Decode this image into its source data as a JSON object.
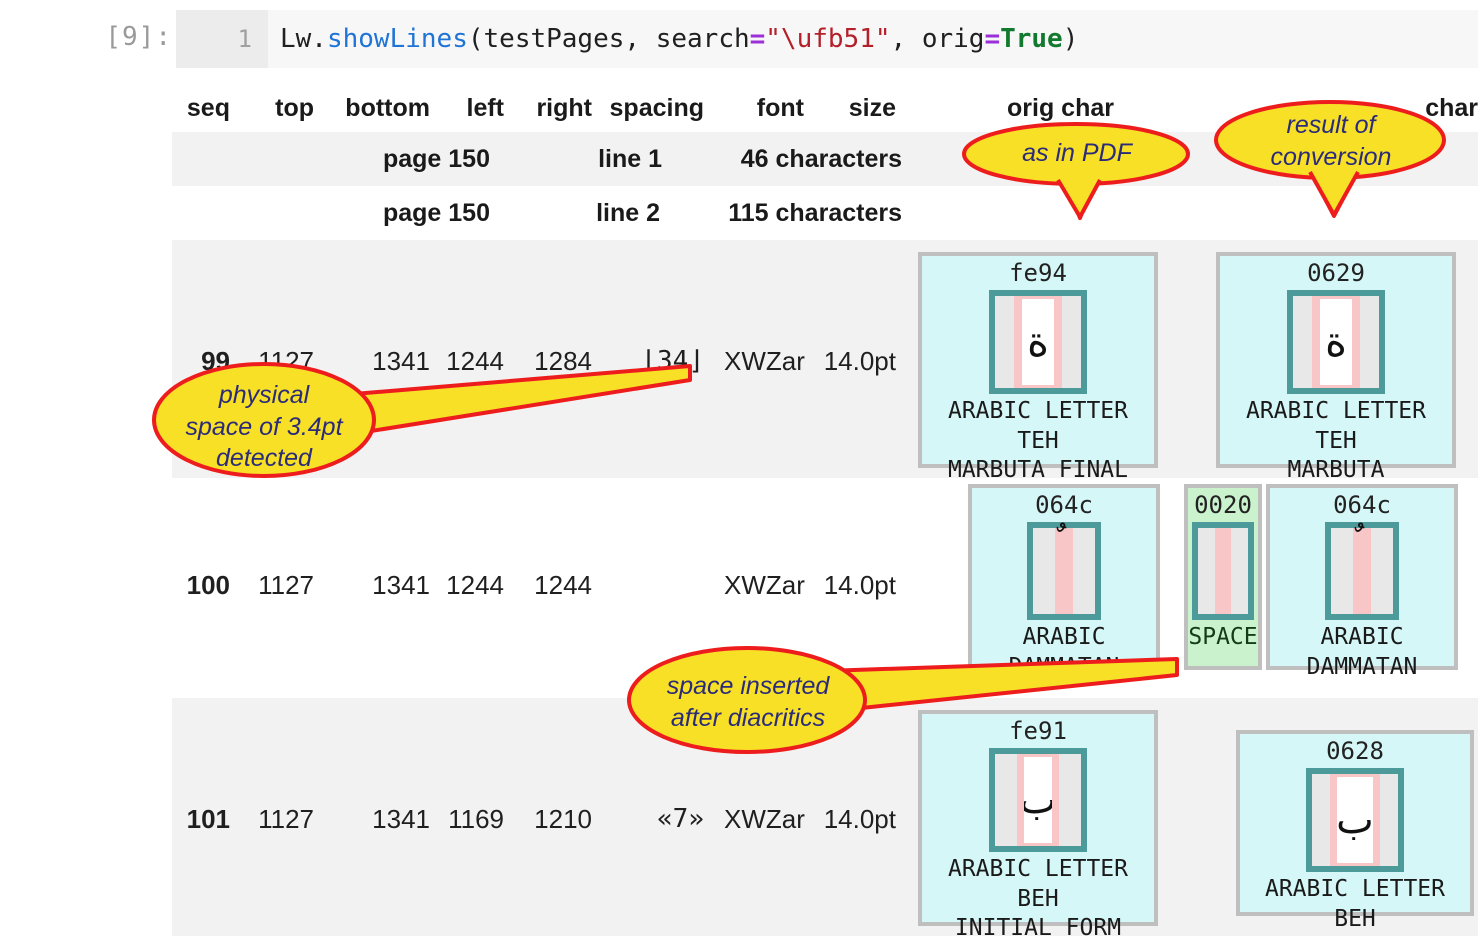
{
  "notebook": {
    "prompt": "[9]:",
    "line_number": "1",
    "code": {
      "p1": "Lw.",
      "fn": "showLines",
      "p2": "(testPages, search",
      "op1": "=",
      "str": "\"\\ufb51\"",
      "p3": ", orig",
      "op2": "=",
      "kw": "True",
      "p4": ")"
    }
  },
  "table": {
    "headers": {
      "seq": "seq",
      "top": "top",
      "bottom": "bottom",
      "left": "left",
      "right": "right",
      "spacing": "spacing",
      "font": "font",
      "size": "size",
      "orig_char": "orig char",
      "char": "char"
    },
    "info_rows": [
      {
        "page": "page 150",
        "line": "line 1",
        "chars": "46 characters"
      },
      {
        "page": "page 150",
        "line": "line 2",
        "chars": "115 characters"
      }
    ],
    "rows": [
      {
        "seq": "99",
        "top": "1127",
        "bottom": "1341",
        "left": "1244",
        "right": "1284",
        "spacing": "⌊34⌋",
        "font": "XWZar",
        "size": "14.0pt",
        "orig_chars": [
          {
            "code": "fe94",
            "glyph": "ة",
            "name": "ARABIC LETTER TEH\nMARBUTA FINAL FORM",
            "kind": "letter"
          }
        ],
        "chars": [
          {
            "code": "0629",
            "glyph": "ة",
            "name": "ARABIC LETTER TEH\nMARBUTA",
            "kind": "letter"
          }
        ]
      },
      {
        "seq": "100",
        "top": "1127",
        "bottom": "1341",
        "left": "1244",
        "right": "1244",
        "spacing": "",
        "font": "XWZar",
        "size": "14.0pt",
        "orig_chars": [
          {
            "code": "064c",
            "glyph": "ٌ",
            "name": "ARABIC DAMMATAN",
            "kind": "mark"
          }
        ],
        "chars": [
          {
            "code": "0020",
            "glyph": "",
            "name": "SPACE",
            "kind": "space"
          },
          {
            "code": "064c",
            "glyph": "ٌ",
            "name": "ARABIC DAMMATAN",
            "kind": "mark"
          }
        ]
      },
      {
        "seq": "101",
        "top": "1127",
        "bottom": "1341",
        "left": "1169",
        "right": "1210",
        "spacing": "«7»",
        "font": "XWZar",
        "size": "14.0pt",
        "orig_chars": [
          {
            "code": "fe91",
            "glyph": "ب",
            "name": "ARABIC LETTER BEH\nINITIAL FORM",
            "kind": "letter"
          }
        ],
        "chars": [
          {
            "code": "0628",
            "glyph": "ب",
            "name": "ARABIC LETTER BEH",
            "kind": "letter"
          }
        ]
      }
    ]
  },
  "callouts": [
    {
      "id": "as-in-pdf",
      "text": "as in PDF"
    },
    {
      "id": "result-of-conversion",
      "text": "result of\nconversion"
    },
    {
      "id": "physical-space",
      "text": "physical\nspace of 3.4pt\ndetected"
    },
    {
      "id": "space-inserted",
      "text": "space inserted\nafter diacritics"
    }
  ],
  "colors": {
    "callout_fill": "#f7e026",
    "callout_stroke": "#ee1d1d",
    "callout_text": "#2b2b7a",
    "char_cell_bg": "#d6f7f7",
    "space_cell_bg": "#c9f2cd",
    "art_border": "#4c9a9a",
    "band": "#f9c6c8",
    "row_stripe": "#f2f2f2",
    "code_bg": "#f7f7f7",
    "gutter_bg": "#ececec"
  }
}
